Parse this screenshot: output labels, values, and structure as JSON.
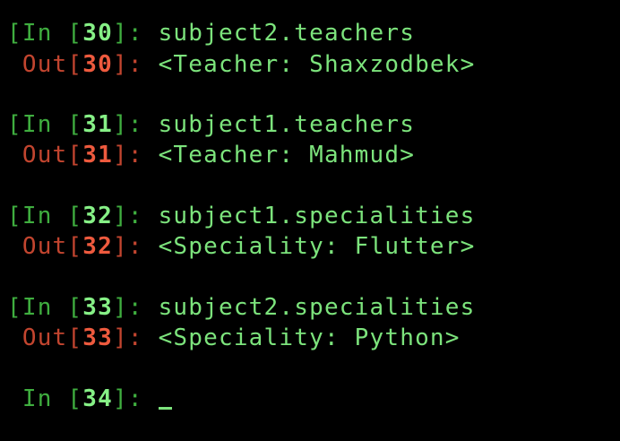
{
  "colors": {
    "background": "#000000",
    "in_prompt": "#3fae3f",
    "in_number": "#86f086",
    "out_prompt": "#c2452f",
    "out_number": "#ee5a3e",
    "text": "#7ce37c"
  },
  "cells": [
    {
      "in_label": "[In [",
      "number": "30",
      "in_close": "]: ",
      "code": "subject2.teachers",
      "out_label": " Out[",
      "out_number": "30",
      "out_close": "]: ",
      "result": "<Teacher: Shaxzodbek>"
    },
    {
      "in_label": "[In [",
      "number": "31",
      "in_close": "]: ",
      "code": "subject1.teachers",
      "out_label": " Out[",
      "out_number": "31",
      "out_close": "]: ",
      "result": "<Teacher: Mahmud>"
    },
    {
      "in_label": "[In [",
      "number": "32",
      "in_close": "]: ",
      "code": "subject1.specialities",
      "out_label": " Out[",
      "out_number": "32",
      "out_close": "]: ",
      "result": "<Speciality: Flutter>"
    },
    {
      "in_label": "[In [",
      "number": "33",
      "in_close": "]: ",
      "code": "subject2.specialities",
      "out_label": " Out[",
      "out_number": "33",
      "out_close": "]: ",
      "result": "<Speciality: Python>"
    }
  ],
  "prompt": {
    "in_label": " In [",
    "number": "34",
    "in_close": "]: "
  },
  "cursor_icon": "underscore-cursor-icon"
}
